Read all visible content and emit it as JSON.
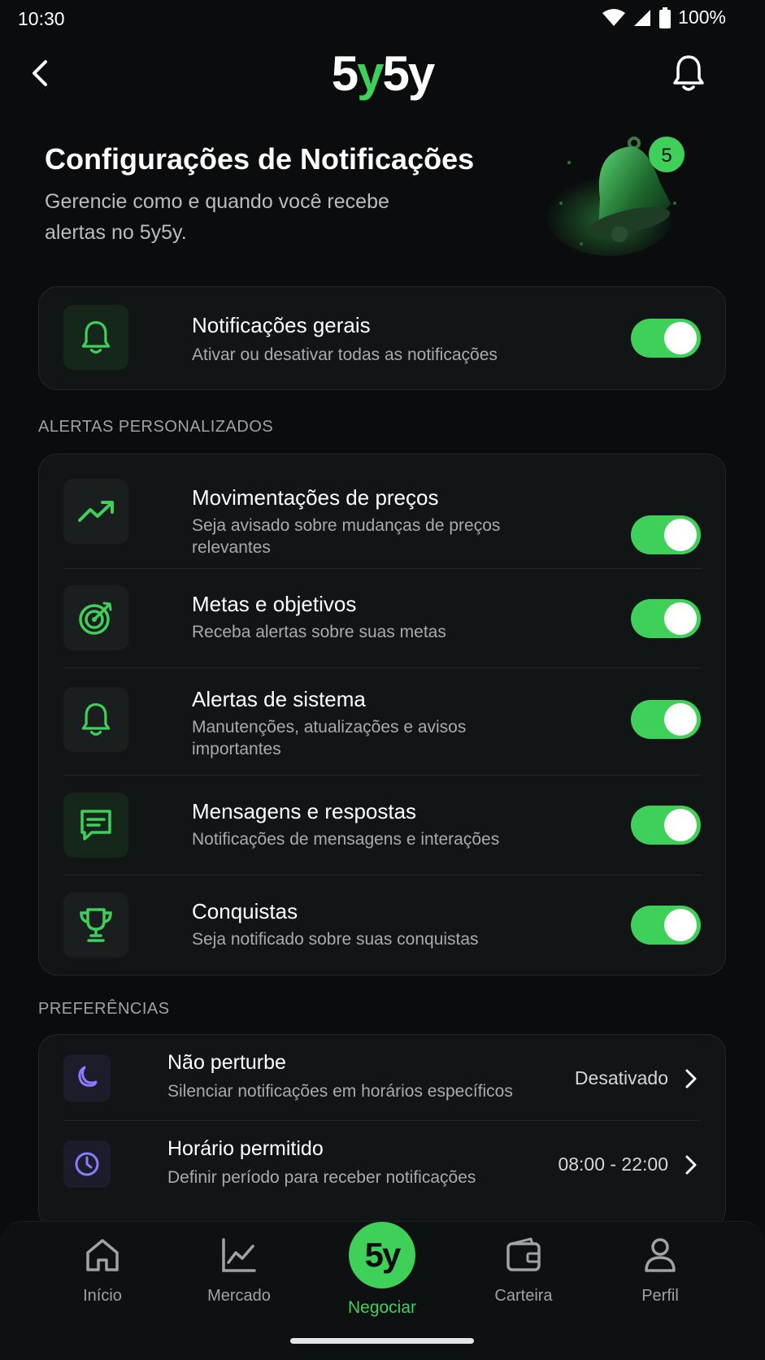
{
  "status": {
    "time": "10:30",
    "battery": "100%"
  },
  "header": {
    "logo_part1": "5",
    "logo_part2": "y",
    "logo_part3": "5y",
    "badge_count": "5"
  },
  "hero": {
    "title": "Configurações de Notificações",
    "subtitle": "Gerencie como e quando você recebe alertas no 5y5y."
  },
  "general": {
    "title": "Notificações gerais",
    "subtitle": "Ativar ou desativar todas as notificações",
    "enabled": true
  },
  "custom_alerts": {
    "label": "ALERTAS PERSONALIZADOS",
    "items": [
      {
        "title": "Movimentações de preços",
        "subtitle": "Seja avisado sobre mudanças de preços relevantes",
        "icon": "trending-up-icon",
        "enabled": true
      },
      {
        "title": "Metas e objetivos",
        "subtitle": "Receba alertas sobre suas metas",
        "icon": "target-icon",
        "enabled": true
      },
      {
        "title": "Alertas de sistema",
        "subtitle": "Manutenções, atualizações e avisos importantes",
        "icon": "bell-icon",
        "enabled": true
      },
      {
        "title": "Mensagens e respostas",
        "subtitle": "Notificações de mensagens e interações",
        "icon": "message-icon",
        "enabled": true
      },
      {
        "title": "Conquistas",
        "subtitle": "Seja notificado sobre suas conquistas",
        "icon": "trophy-icon",
        "enabled": true
      }
    ]
  },
  "preferences": {
    "label": "PREFERÊNCIAS",
    "items": [
      {
        "title": "Não perturbe",
        "subtitle": "Silenciar notificações em horários específicos",
        "value": "Desativado",
        "icon": "moon-icon"
      },
      {
        "title": "Horário permitido",
        "subtitle": "Definir período para receber notificações",
        "value": "08:00 - 22:00",
        "icon": "clock-icon"
      }
    ]
  },
  "nav": {
    "items": [
      {
        "label": "Início",
        "icon": "home-icon"
      },
      {
        "label": "Mercado",
        "icon": "chart-icon"
      },
      {
        "label": "Negociar",
        "icon": "5y-logo",
        "logo_text": "5y",
        "active": true
      },
      {
        "label": "Carteira",
        "icon": "wallet-icon"
      },
      {
        "label": "Perfil",
        "icon": "user-icon"
      }
    ]
  },
  "colors": {
    "accent": "#3fd05a",
    "background": "#0a0c0d",
    "card": "#121516",
    "purple": "#8b7cff"
  }
}
